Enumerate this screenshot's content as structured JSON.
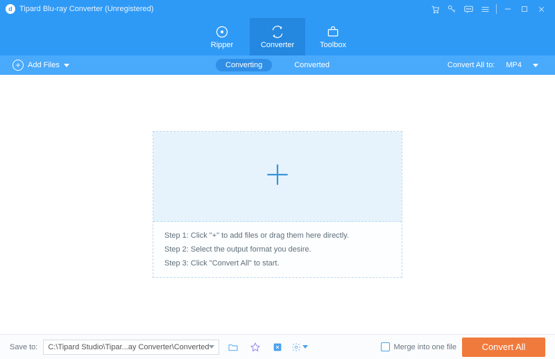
{
  "titlebar": {
    "app_title": "Tipard Blu-ray Converter (Unregistered)"
  },
  "nav": {
    "ripper": "Ripper",
    "converter": "Converter",
    "toolbox": "Toolbox"
  },
  "subbar": {
    "add_files": "Add Files",
    "tab_converting": "Converting",
    "tab_converted": "Converted",
    "convert_all_to": "Convert All to:",
    "format": "MP4"
  },
  "dropzone": {
    "step1": "Step 1: Click \"+\" to add files or drag them here directly.",
    "step2": "Step 2: Select the output format you desire.",
    "step3": "Step 3: Click \"Convert All\" to start."
  },
  "footer": {
    "save_to_label": "Save to:",
    "save_path": "C:\\Tipard Studio\\Tipar...ay Converter\\Converted",
    "merge_label": "Merge into one file",
    "convert_all": "Convert All"
  }
}
